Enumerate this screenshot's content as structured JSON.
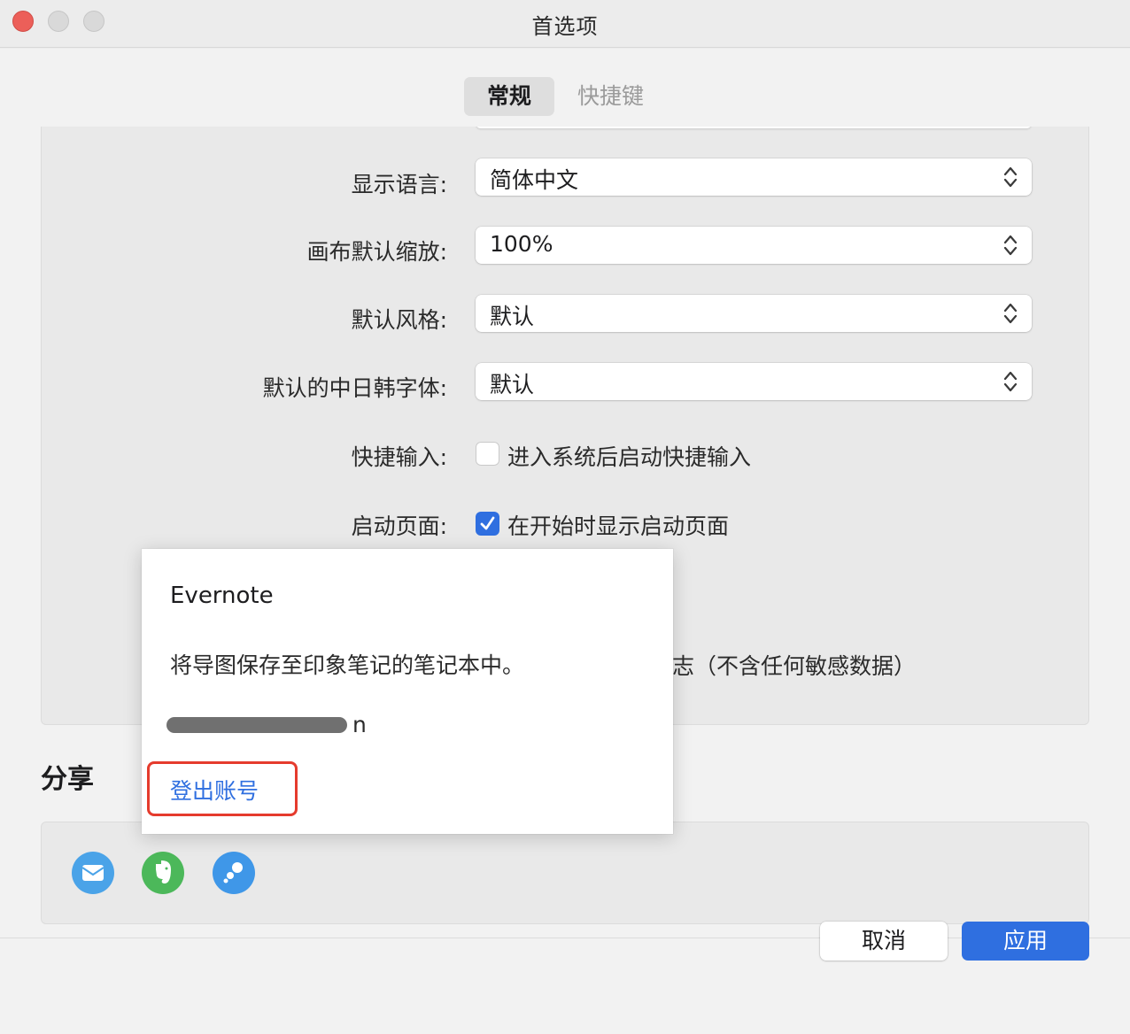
{
  "window": {
    "title": "首选项"
  },
  "tabs": [
    {
      "label": "常规",
      "active": true
    },
    {
      "label": "快捷键",
      "active": false
    }
  ],
  "settings": {
    "display_language": {
      "label": "显示语言:",
      "value": "简体中文"
    },
    "canvas_zoom": {
      "label": "画布默认缩放:",
      "value": "100%"
    },
    "default_style": {
      "label": "默认风格:",
      "value": "默认"
    },
    "cjk_font": {
      "label": "默认的中日韩字体:",
      "value": "默认"
    },
    "quick_input": {
      "label": "快捷输入:",
      "option": "进入系统后启动快捷输入",
      "checked": false
    },
    "startup_page": {
      "label": "启动页面:",
      "option": "在开始时显示启动页面",
      "checked": true
    },
    "log_option_visible_tail": "志（不含任何敏感数据）"
  },
  "share": {
    "title": "分享",
    "icons": [
      {
        "name": "mail-icon",
        "color": "#4aa3e8"
      },
      {
        "name": "evernote-icon",
        "color": "#4cb85a"
      },
      {
        "name": "bubble-share-icon",
        "color": "#3f97e8"
      }
    ]
  },
  "popover": {
    "title": "Evernote",
    "description": "将导图保存至印象笔记的笔记本中。",
    "account_tail": "n",
    "logout": "登出账号"
  },
  "footer": {
    "cancel": "取消",
    "apply": "应用"
  },
  "colors": {
    "accent": "#2f6fe0",
    "highlight": "#e53b2d"
  }
}
